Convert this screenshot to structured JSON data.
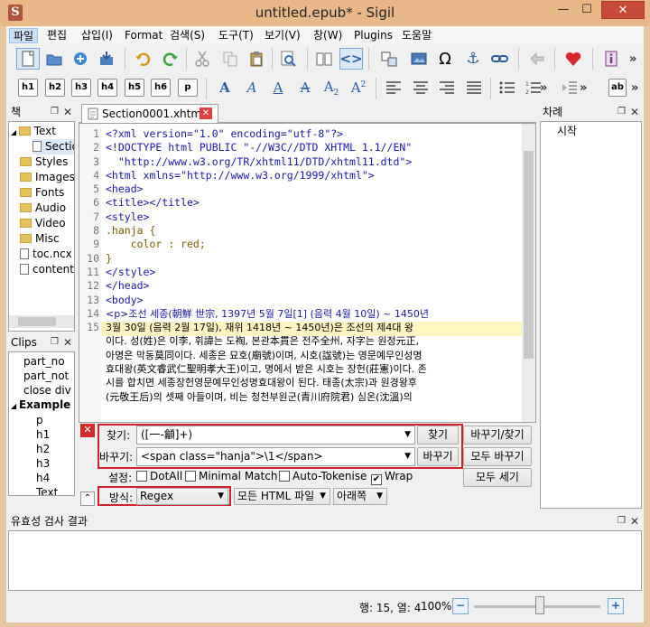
{
  "window": {
    "title": "untitled.epub* - Sigil",
    "app_icon": "S",
    "min_glyph": "—",
    "max_glyph": "☐",
    "close_glyph": "✕"
  },
  "menu": [
    "파일",
    "편집",
    "삽입(I)",
    "Format",
    "검색(S)",
    "도구(T)",
    "보기(V)",
    "창(W)",
    "Plugins",
    "도움말"
  ],
  "toolbar1": {
    "icons": [
      "new-book-icon",
      "open-icon",
      "add-file-icon",
      "save-icon",
      "undo-icon",
      "redo-icon",
      "cut-icon",
      "copy-icon",
      "paste-icon",
      "find-icon",
      "book-view-icon",
      "code-view-icon",
      "split-icon",
      "image-icon",
      "omega-icon",
      "anchor-icon",
      "link-icon",
      "back-icon",
      "heart-icon",
      "info-icon"
    ],
    "omega_glyph": "Ω",
    "anchor_glyph": "⚓",
    "more": "»"
  },
  "toolbar2": {
    "headings": [
      "h1",
      "h2",
      "h3",
      "h4",
      "h5",
      "h6",
      "p"
    ],
    "more": "»",
    "ab_label": "ab"
  },
  "book_browser": {
    "title": "책",
    "items": [
      "Text",
      "Section",
      "Styles",
      "Images",
      "Fonts",
      "Audio",
      "Video",
      "Misc",
      "toc.ncx",
      "content."
    ]
  },
  "clips": {
    "title": "Clips",
    "items": [
      "part_no",
      "part_not",
      "close div",
      "Example",
      "p",
      "h1",
      "h2",
      "h3",
      "h4",
      "Text"
    ]
  },
  "toc": {
    "title": "차례",
    "items": [
      "시작"
    ]
  },
  "tab": {
    "label": "Section0001.xhtml"
  },
  "editor": {
    "lines": [
      {
        "n": "1",
        "text": "<?xml version=\"1.0\" encoding=\"utf-8\"?>"
      },
      {
        "n": "2",
        "text": "<!DOCTYPE html PUBLIC \"-//W3C//DTD XHTML 1.1//EN\""
      },
      {
        "n": "3",
        "text": "  \"http://www.w3.org/TR/xhtml11/DTD/xhtml11.dtd\">"
      },
      {
        "n": "4",
        "text": ""
      },
      {
        "n": "5",
        "text": "<html xmlns=\"http://www.w3.org/1999/xhtml\">"
      },
      {
        "n": "6",
        "text": "<head>"
      },
      {
        "n": "7",
        "text": "<title></title>"
      },
      {
        "n": "8",
        "text": "<style>"
      },
      {
        "n": "9",
        "text": ".hanja {"
      },
      {
        "n": "10",
        "text": "    color : red;"
      },
      {
        "n": "11",
        "text": "}"
      },
      {
        "n": "12",
        "text": "</style>"
      },
      {
        "n": "13",
        "text": "</head>"
      },
      {
        "n": "14",
        "text": "<body>"
      },
      {
        "n": "15",
        "text": "<p>조선 세종(朝鮮 世宗, 1397년 5월 7일[1] (음력 4월 10일) ~ 1450년"
      }
    ],
    "wrapped": [
      "3월 30일 (음력 2월 17일), 재위 1418년 ~ 1450년)은 조선의 제4대 왕",
      "이다. 성(姓)은 이李, 휘諱는 도祹, 본관本貫은 전주全州, 자字는 원정元正,",
      "아명은 막동莫同이다. 세종은 묘호(廟號)이며, 시호(諡號)는 영문예무인성명",
      "효대왕(英文睿武仁聖明孝大王)이고, 명에서 받은 시호는 장헌(莊憲)이다. 존",
      "시를 합치면 세종장헌영문예무인성명효대왕이 된다. 태종(太宗)과 원경왕후",
      "(元敬王后)의 셋째 아들이며, 비는 청천부원군(青川府院君) 심온(沈溫)의"
    ]
  },
  "find_replace": {
    "find_label": "찾기:",
    "find_value": "([一-龥]+)",
    "find_btn": "찾기",
    "replace_find_btn": "바꾸기/찾기",
    "replace_label": "바꾸기:",
    "replace_value": "<span class=\"hanja\">\\1</span>",
    "replace_btn": "바꾸기",
    "replace_all_btn": "모두 바꾸기",
    "settings_label": "설정:",
    "dotall": "DotAll",
    "minimal": "Minimal Match",
    "autotoken": "Auto-Tokenise",
    "wrap": "Wrap",
    "count_all_btn": "모두 세기",
    "mode_label": "방식:",
    "mode_value": "Regex",
    "scope_value": "모든 HTML 파일",
    "direction_value": "아래쪽"
  },
  "validation": {
    "title": "유효성 검사 결과"
  },
  "status": {
    "position": "행: 15, 열: 4",
    "zoom": "100%"
  },
  "colors": {
    "titlebar": "#e9b888",
    "close": "#c7493a",
    "highlight": "#fff5c0",
    "tag": "#1a1aa6",
    "string": "#b21aa6",
    "hanja_red": "#d3202a"
  }
}
